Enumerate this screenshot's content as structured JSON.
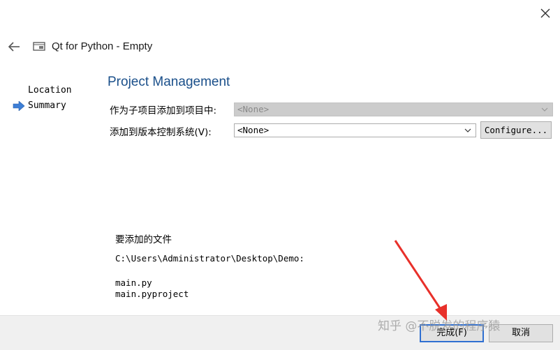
{
  "wizard": {
    "title": "Qt for Python - Empty",
    "steps": [
      {
        "label": "Location"
      },
      {
        "label": "Summary"
      }
    ]
  },
  "page": {
    "title": "Project Management",
    "add_subproject_label": "作为子项目添加到项目中:",
    "add_subproject_value": "<None>",
    "vcs_label": "添加到版本控制系统(V):",
    "vcs_value": "<None>",
    "configure_label": "Configure...",
    "files_heading": "要添加的文件",
    "path": "C:\\Users\\Administrator\\Desktop\\Demo:",
    "files": [
      "main.py",
      "main.pyproject"
    ]
  },
  "buttons": {
    "finish_label": "完成(F)",
    "cancel_label": "取消"
  },
  "watermark": {
    "text": "知乎 @不脱发的程序猿"
  },
  "colors": {
    "title_blue": "#1a4f8a",
    "arrow_blue": "#3d7fd6",
    "annotation_red": "#e8302a"
  }
}
